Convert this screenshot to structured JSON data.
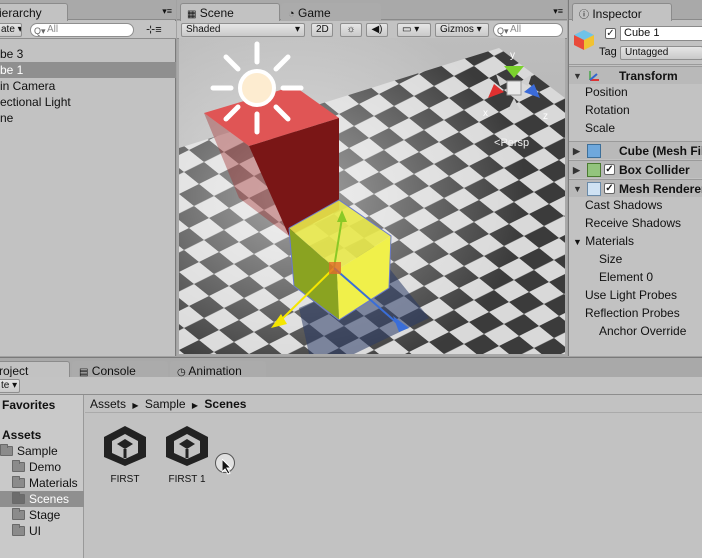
{
  "hierarchy": {
    "tab": "ierarchy",
    "create": "ate",
    "search_placeholder": "All",
    "items": [
      {
        "label": "be 3",
        "selected": false
      },
      {
        "label": "be 1",
        "selected": true
      },
      {
        "label": "in Camera",
        "selected": false
      },
      {
        "label": "ectional Light",
        "selected": false
      },
      {
        "label": "ne",
        "selected": false
      }
    ]
  },
  "scene": {
    "tabs": {
      "scene": "Scene",
      "game": "Game"
    },
    "shading": "Shaded",
    "mode_2d": "2D",
    "gizmos": "Gizmos",
    "search_placeholder": "All",
    "projection": "Persp",
    "axes": {
      "x": "x",
      "y": "y",
      "z": "z"
    }
  },
  "inspector": {
    "tab": "Inspector",
    "object_name": "Cube 1",
    "tag_label": "Tag",
    "tag_value": "Untagged",
    "components": {
      "transform": "Transform",
      "position": "Position",
      "rotation": "Rotation",
      "scale": "Scale",
      "mesh_filter": "Cube (Mesh Fil",
      "box_collider": "Box Collider",
      "mesh_renderer": "Mesh Renderer",
      "cast_shadows": "Cast Shadows",
      "receive_shadows": "Receive Shadows",
      "materials": "Materials",
      "size": "Size",
      "element0": "Element 0",
      "use_light_probes": "Use Light Probes",
      "reflection_probes": "Reflection Probes",
      "anchor_override": "Anchor Override"
    }
  },
  "bottom": {
    "tabs": {
      "project": "roject",
      "console": "Console",
      "animation": "Animation"
    },
    "create": "te",
    "favorites": "Favorites",
    "assets": "Assets",
    "tree": [
      "Sample",
      "Demo",
      "Materials",
      "Scenes",
      "Stage",
      "UI"
    ],
    "breadcrumb": {
      "a": "Assets",
      "b": "Sample",
      "c": "Scenes"
    },
    "files": [
      "FIRST",
      "FIRST 1"
    ]
  },
  "colors": {
    "accent_selected": "#8f8f8f",
    "panel": "#c2c2c2"
  }
}
